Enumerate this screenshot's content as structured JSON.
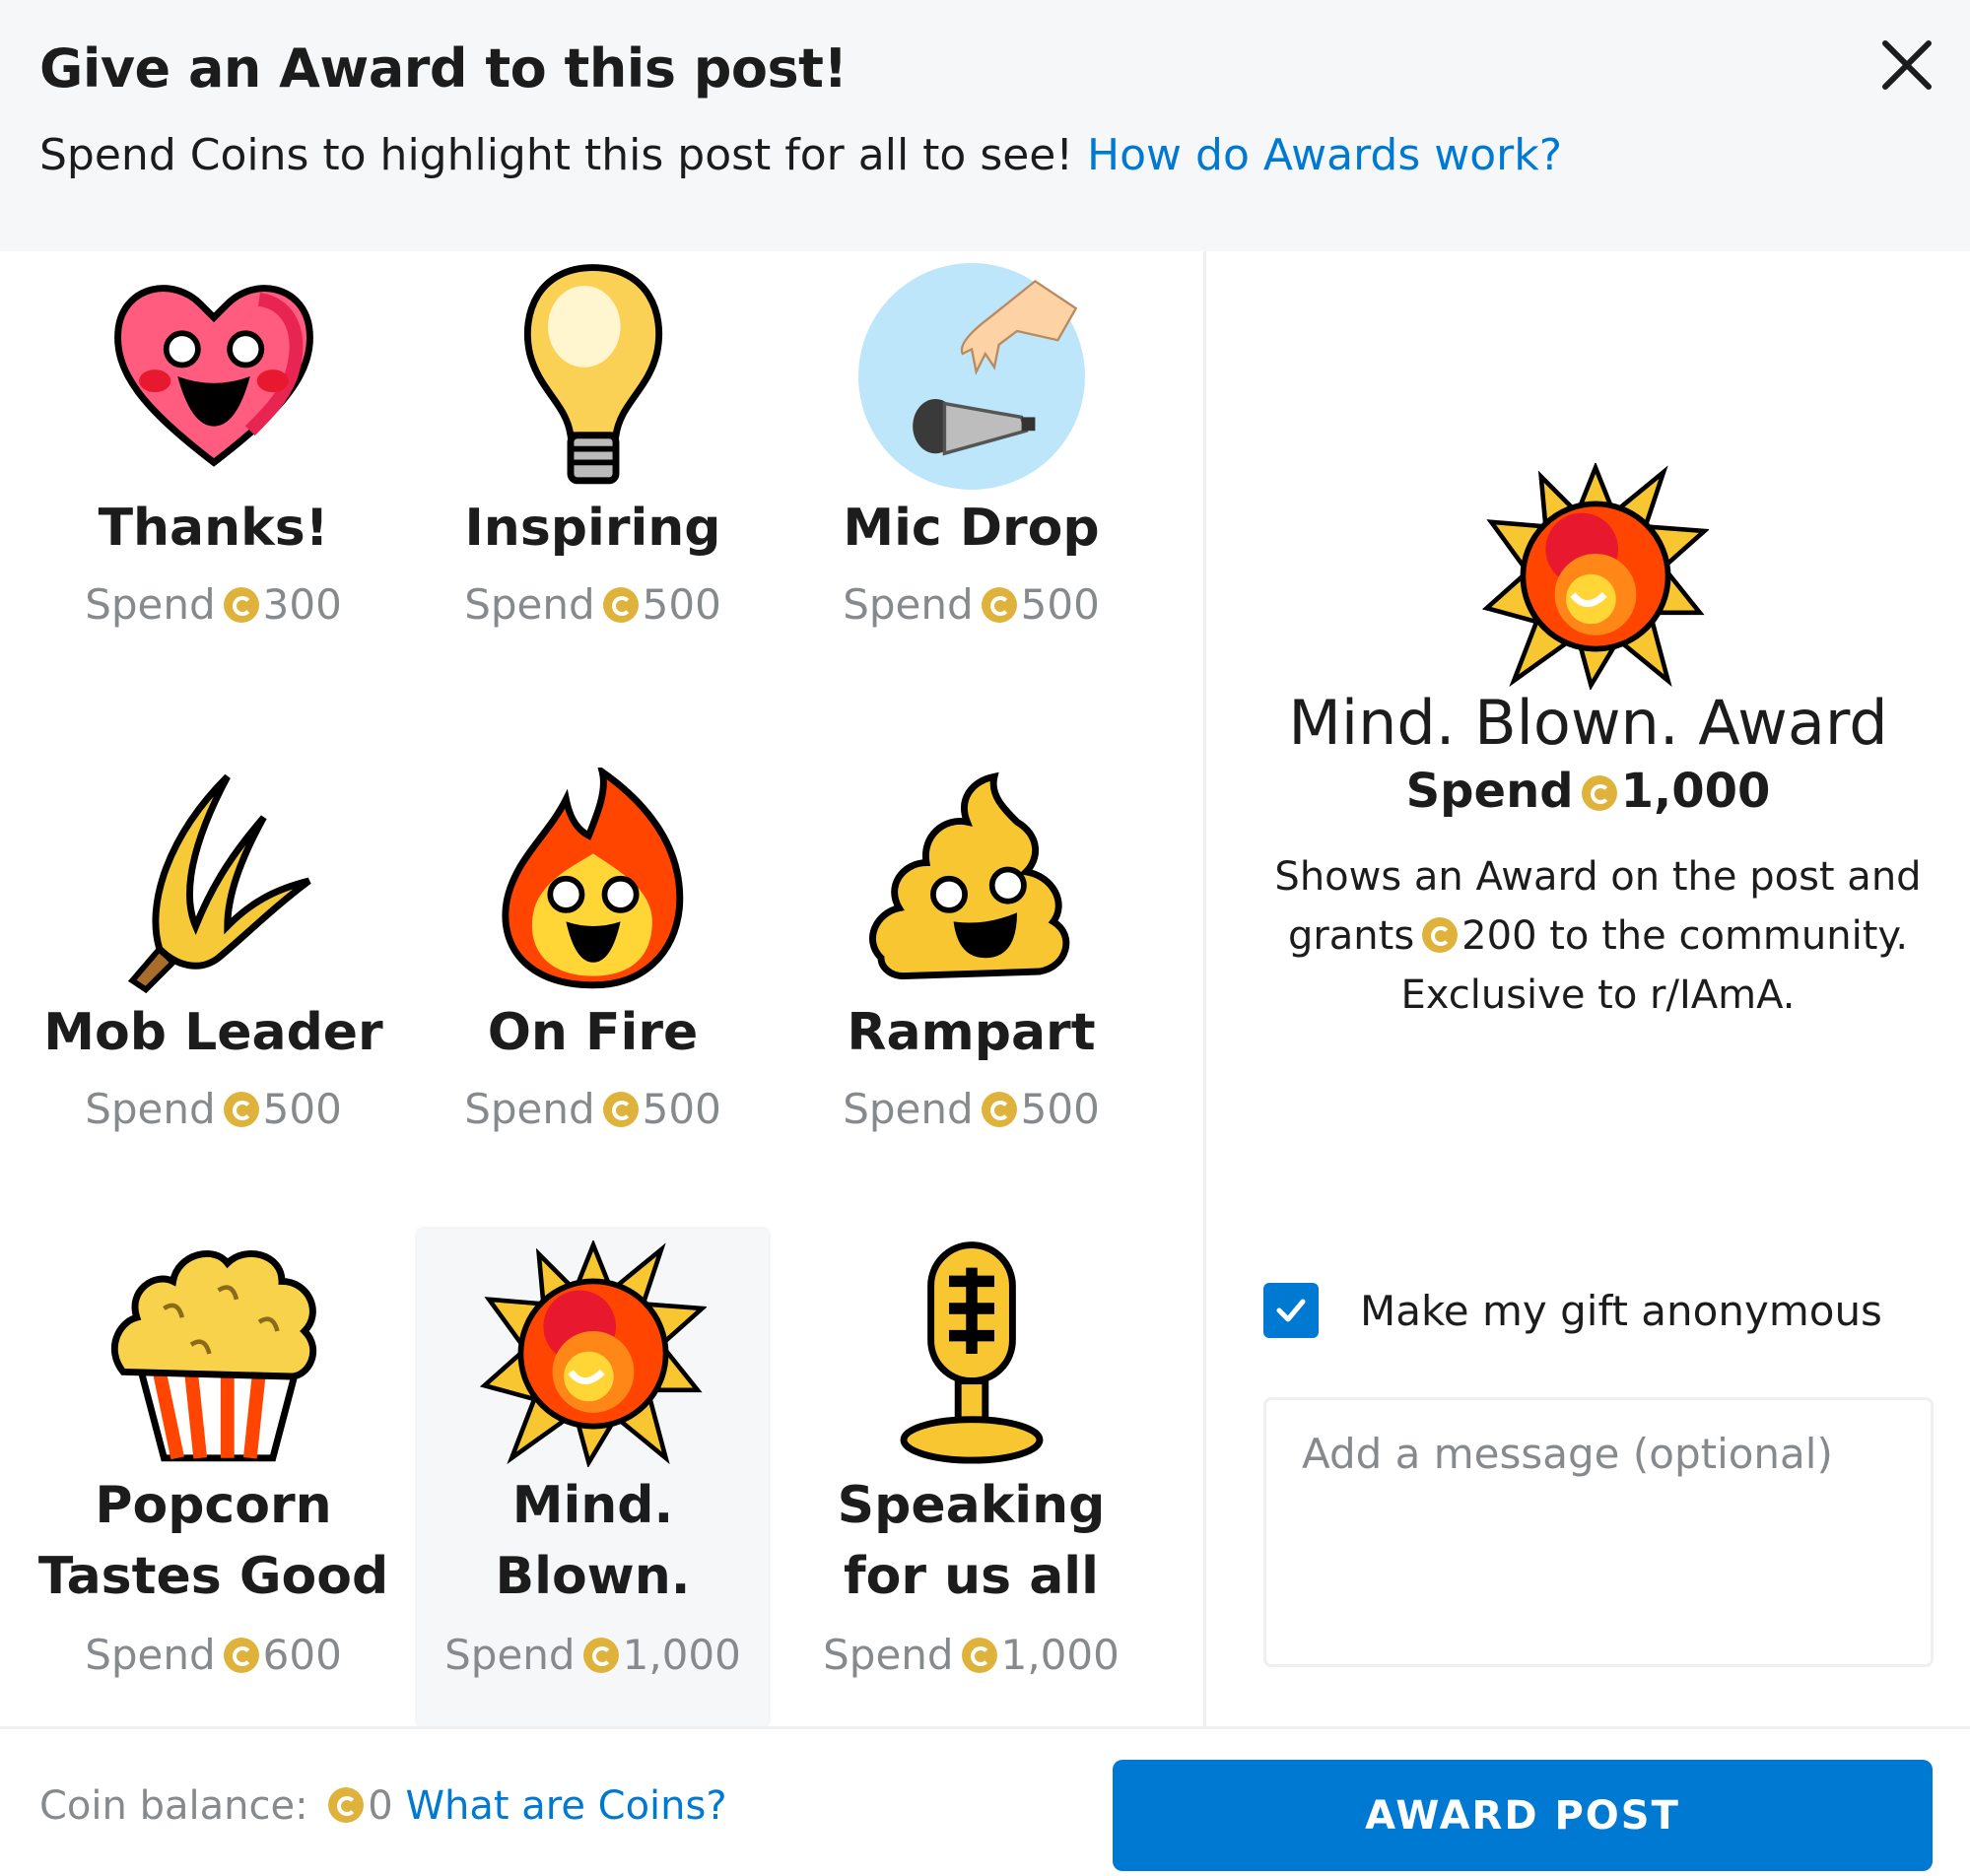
{
  "header": {
    "title": "Give an Award to this post!",
    "subtitle": "Spend Coins to highlight this post for all to see!",
    "help_link": "How do Awards work?",
    "close_icon": "close-icon"
  },
  "coin_icon": "coin-icon",
  "colors": {
    "accent": "#0079d3",
    "coin": "#dfb33b",
    "muted": "#878a8c",
    "selected_bg": "#f6f7f8"
  },
  "awards": [
    {
      "name": "Thanks!",
      "spend_label": "Spend",
      "cost": "300",
      "icon": "heart-icon",
      "selected": false
    },
    {
      "name": "Inspiring",
      "spend_label": "Spend",
      "cost": "500",
      "icon": "lightbulb-icon",
      "selected": false
    },
    {
      "name": "Mic Drop",
      "spend_label": "Spend",
      "cost": "500",
      "icon": "mic-drop-icon",
      "selected": false
    },
    {
      "name": "Mob Leader",
      "spend_label": "Spend",
      "cost": "500",
      "icon": "pitchfork-icon",
      "selected": false
    },
    {
      "name": "On Fire",
      "spend_label": "Spend",
      "cost": "500",
      "icon": "fire-icon",
      "selected": false
    },
    {
      "name": "Rampart",
      "spend_label": "Spend",
      "cost": "500",
      "icon": "poop-icon",
      "selected": false
    },
    {
      "name": "Popcorn Tastes Good",
      "spend_label": "Spend",
      "cost": "600",
      "icon": "popcorn-icon",
      "selected": false
    },
    {
      "name": "Mind. Blown.",
      "spend_label": "Spend",
      "cost": "1,000",
      "icon": "explosion-icon",
      "selected": true
    },
    {
      "name": "Speaking for us all",
      "spend_label": "Spend",
      "cost": "1,000",
      "icon": "microphone-icon",
      "selected": false
    }
  ],
  "detail": {
    "name": "Mind. Blown. Award",
    "spend_label": "Spend",
    "cost": "1,000",
    "description_pre": "Shows an Award on the post and grants",
    "grant": "200",
    "description_post": "to the community. Exclusive to r/IAmA.",
    "icon": "explosion-icon"
  },
  "anonymous": {
    "label": "Make my gift anonymous",
    "checked": true
  },
  "message": {
    "placeholder": "Add a message (optional)",
    "value": ""
  },
  "footer": {
    "balance_label": "Coin balance:",
    "balance": "0",
    "coins_link": "What are Coins?",
    "award_button": "AWARD POST"
  }
}
